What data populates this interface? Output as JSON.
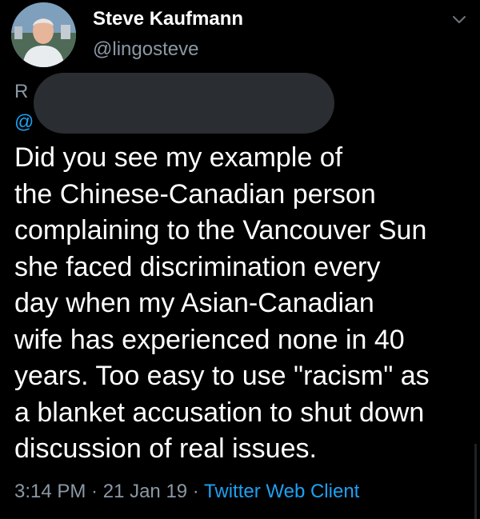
{
  "author": {
    "display_name": "Steve Kaufmann",
    "handle": "@lingosteve"
  },
  "icons": {
    "avatar": "profile-photo",
    "menu": "chevron-down-icon"
  },
  "reply_context": {
    "line1_fragment": "R",
    "line2_fragment": "@"
  },
  "tweet": {
    "lines": [
      "Did you see my example of",
      "the Chinese-Canadian person",
      "complaining to the Vancouver Sun",
      "she faced discrimination every",
      "day when my Asian-Canadian",
      "wife has experienced none in 40",
      "years. Too easy to use \"racism\" as",
      "a blanket accusation to shut down",
      "discussion of real issues."
    ]
  },
  "meta": {
    "time": "3:14 PM",
    "sep1": " · ",
    "date": "21 Jan 19",
    "sep2": " · ",
    "client": "Twitter Web Client"
  },
  "colors": {
    "background": "#000000",
    "text": "#ffffff",
    "secondary": "#8b98a5",
    "link": "#1da1f2",
    "redaction": "#2a2d31"
  }
}
